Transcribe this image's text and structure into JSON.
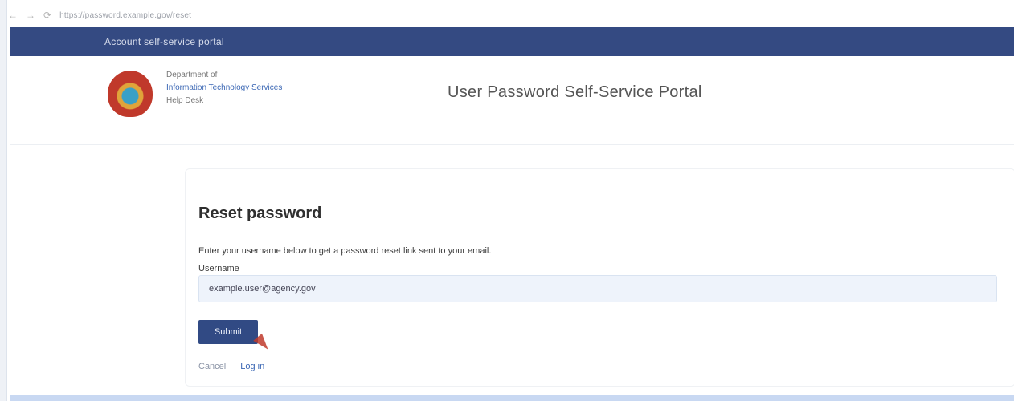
{
  "browser": {
    "nav_icons": [
      "back-arrow-icon",
      "forward-arrow-icon",
      "refresh-icon"
    ],
    "url": "https://password.example.gov/reset"
  },
  "site": {
    "top_bar_title": "Account self-service portal",
    "logo_icon": "seal-logo-icon",
    "unit_lines": [
      "Department of",
      "Information Technology Services",
      "Help Desk"
    ],
    "page_title": "User Password Self-Service Portal"
  },
  "reset_form": {
    "heading": "Reset password",
    "description": "Enter your username below to get a password reset link sent to your email.",
    "username_label": "Username",
    "username_value": "example.user@agency.gov",
    "submit_label": "Submit",
    "cancel_label": "Cancel",
    "login_label": "Log in"
  },
  "colors": {
    "top_bar": "#344a82",
    "button": "#314a84",
    "input_bg": "#eef3fb",
    "link": "#3b67b4"
  }
}
